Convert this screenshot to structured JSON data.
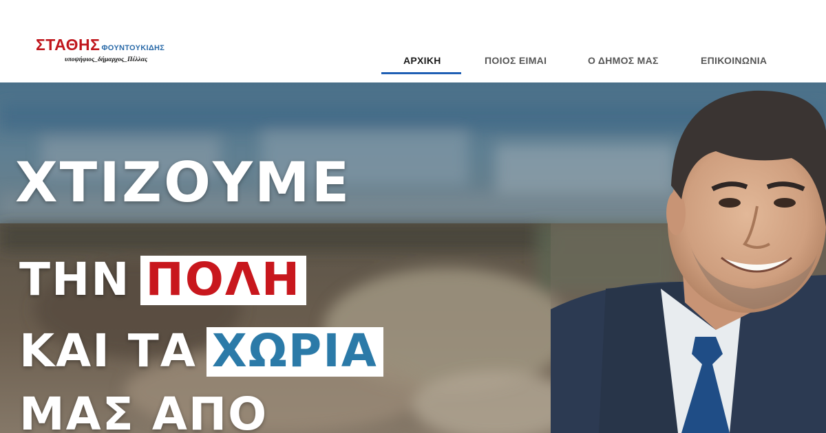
{
  "logo": {
    "first_name": "ΣΤΑΘΗΣ",
    "last_name": "ΦΟΥΝΤΟΥΚΙΔΗΣ",
    "tagline": "υποψήφιος_δήμαρχος_Πέλλας",
    "colors": {
      "first_name": "#c0161c",
      "last_name": "#2a6aa8"
    }
  },
  "nav": {
    "items": [
      {
        "label": "ΑΡΧΙΚΗ",
        "active": true
      },
      {
        "label": "ΠΟΙΟΣ ΕΙΜΑΙ",
        "active": false
      },
      {
        "label": "Ο ΔΗΜΟΣ ΜΑΣ",
        "active": false
      },
      {
        "label": "ΕΠΙΚΟΙΝΩΝΙΑ",
        "active": false
      }
    ],
    "accent": "#1f5fb4"
  },
  "hero": {
    "line1": "ΧΤΙΖΟΥΜΕ",
    "line2_prefix": "ΤΗΝ",
    "line2_highlight": "ΠΟΛΗ",
    "line3_prefix": "ΚΑΙ ΤΑ",
    "line3_highlight": "ΧΩΡΙΑ",
    "line4": "ΜΑΣ ΑΠΟ",
    "colors": {
      "highlight_red": "#c8171d",
      "highlight_blue": "#2b7aa8"
    }
  }
}
